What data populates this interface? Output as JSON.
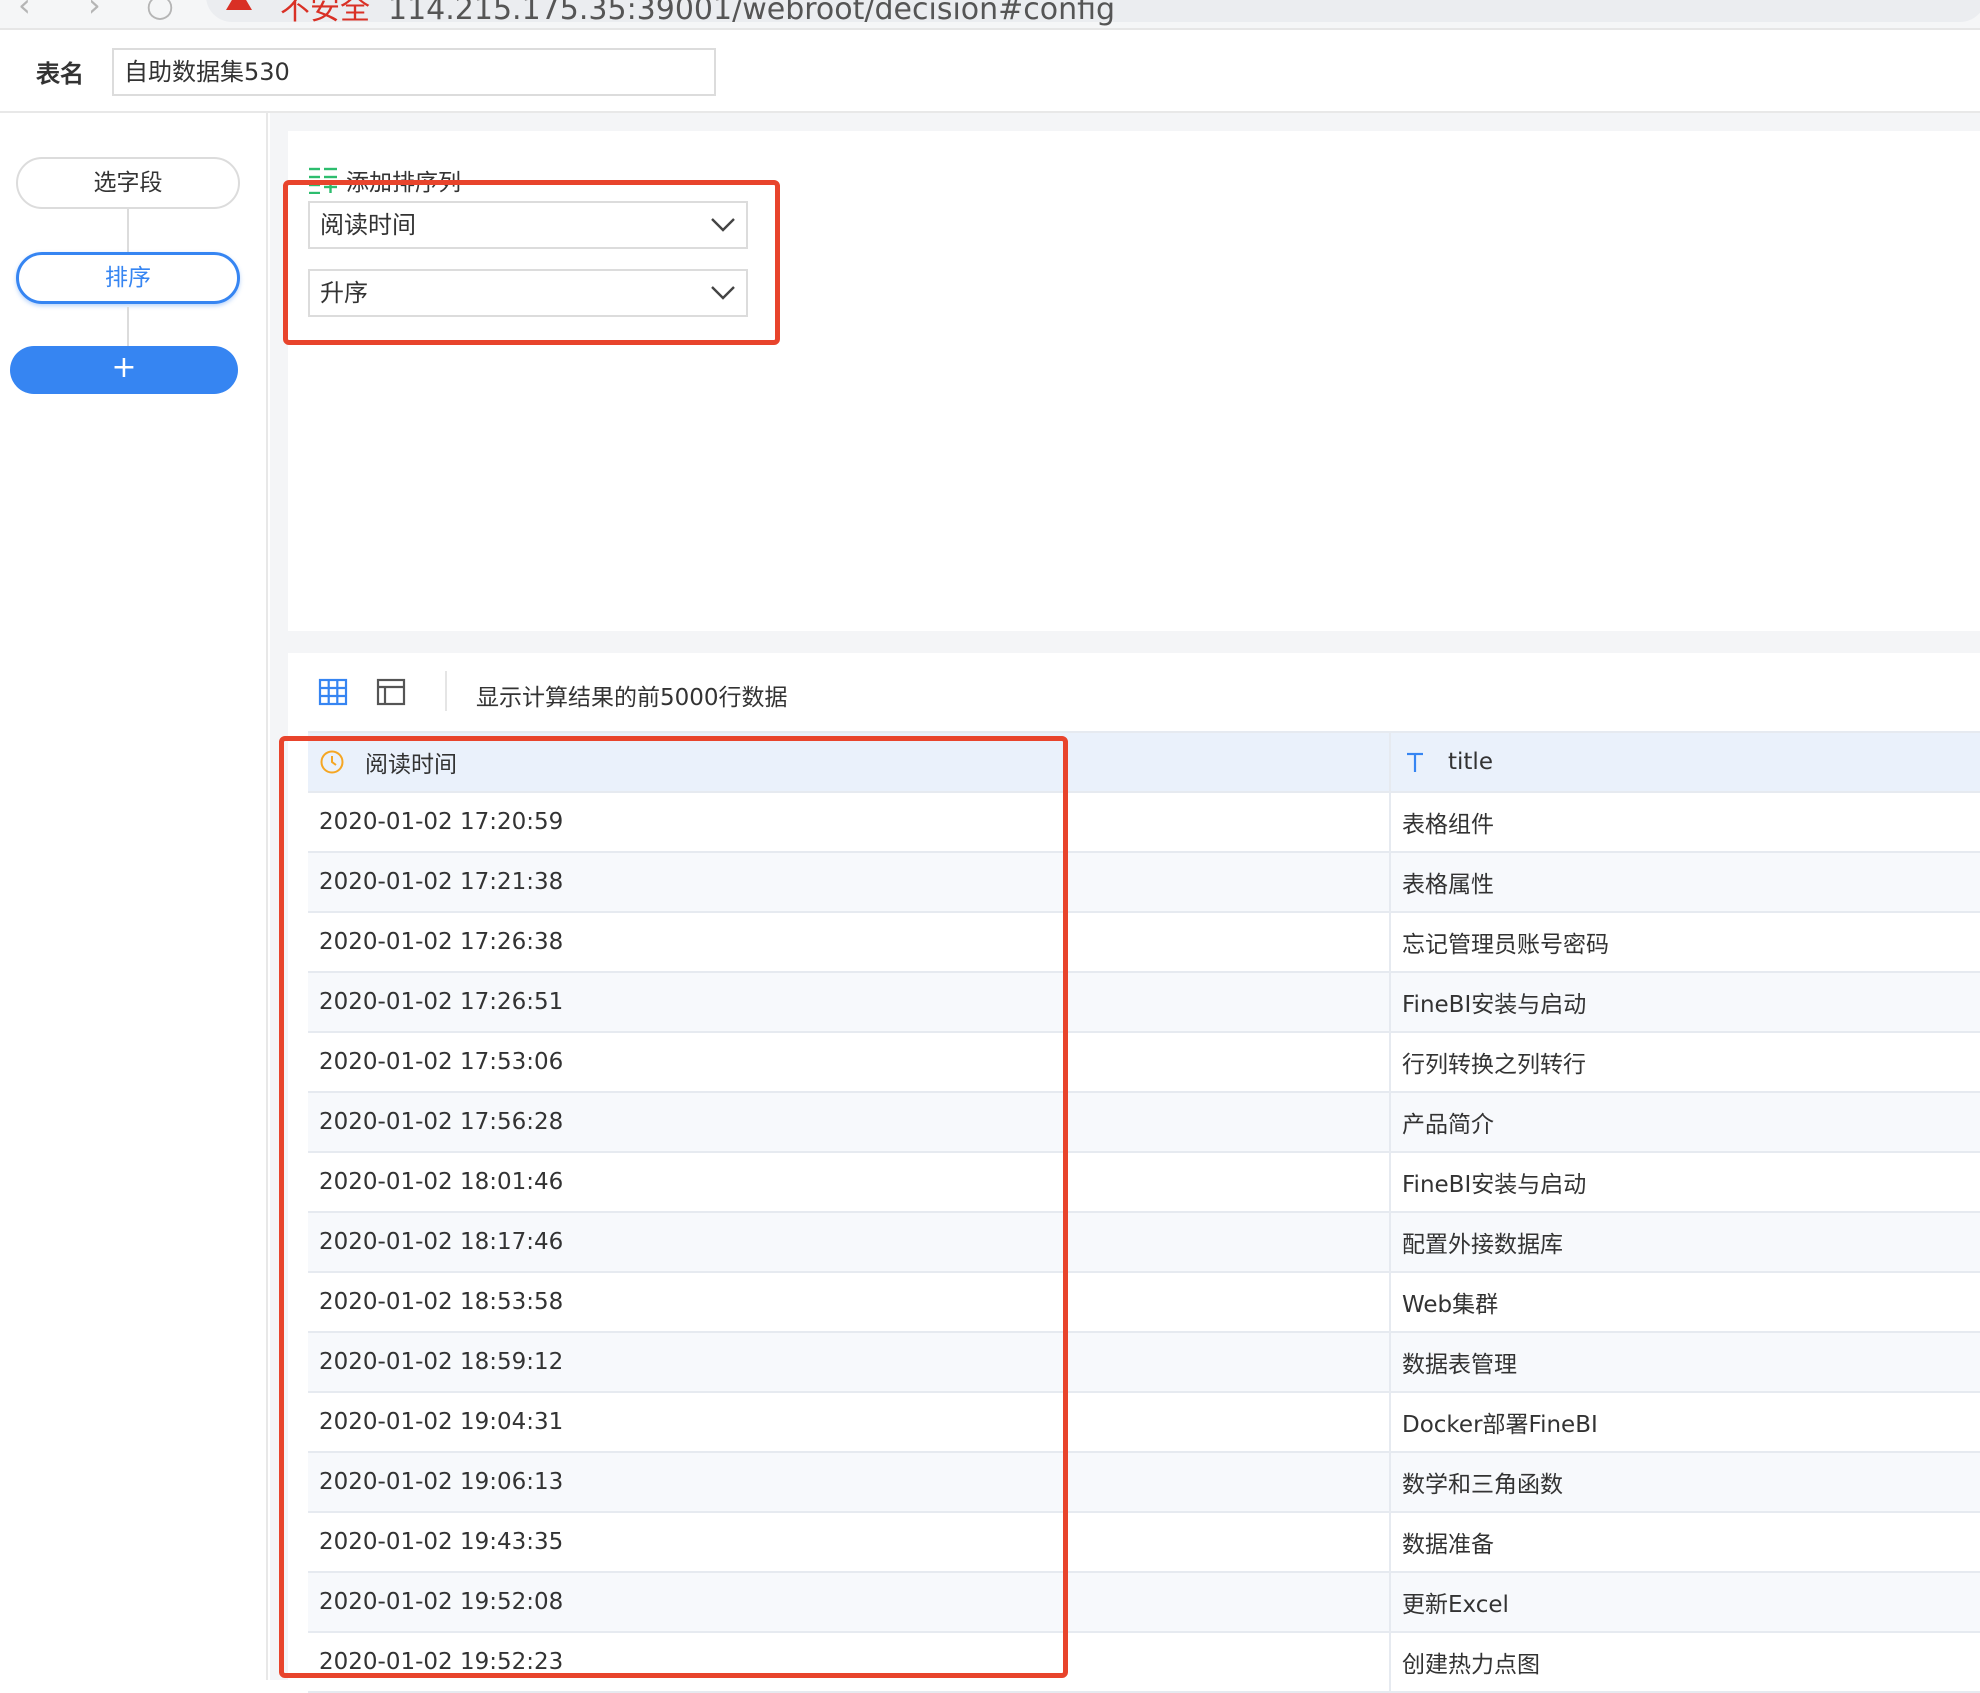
{
  "browser": {
    "security_text": "不安全",
    "url": "114.215.175.35:39001/webroot/decision#config"
  },
  "header": {
    "table_name_label": "表名",
    "table_name_value": "自助数据集530"
  },
  "steps": {
    "select_fields": "选字段",
    "sort": "排序",
    "add": "+"
  },
  "sort_config": {
    "add_sort_column": "添加排序列",
    "field": "阅读时间",
    "order": "升序"
  },
  "preview": {
    "note": "显示计算结果的前5000行数据",
    "columns": [
      {
        "name": "阅读时间",
        "type_icon": "clock-icon"
      },
      {
        "name": "title",
        "type_icon": "text-type-icon"
      }
    ],
    "rows": [
      [
        "2020-01-02 17:20:59",
        "表格组件"
      ],
      [
        "2020-01-02 17:21:38",
        "表格属性"
      ],
      [
        "2020-01-02 17:26:38",
        "忘记管理员账号密码"
      ],
      [
        "2020-01-02 17:26:51",
        "FineBI安装与启动"
      ],
      [
        "2020-01-02 17:53:06",
        "行列转换之列转行"
      ],
      [
        "2020-01-02 17:56:28",
        "产品简介"
      ],
      [
        "2020-01-02 18:01:46",
        "FineBI安装与启动"
      ],
      [
        "2020-01-02 18:17:46",
        "配置外接数据库"
      ],
      [
        "2020-01-02 18:53:58",
        "Web集群"
      ],
      [
        "2020-01-02 18:59:12",
        "数据表管理"
      ],
      [
        "2020-01-02 19:04:31",
        "Docker部署FineBI"
      ],
      [
        "2020-01-02 19:06:13",
        "数学和三角函数"
      ],
      [
        "2020-01-02 19:43:35",
        "数据准备"
      ],
      [
        "2020-01-02 19:52:08",
        "更新Excel"
      ],
      [
        "2020-01-02 19:52:23",
        "创建热力点图"
      ]
    ]
  },
  "colors": {
    "accent": "#3685f2",
    "highlight": "#e8442c",
    "add_sort_icon": "#2dbd6e",
    "clock_icon": "#f5a623"
  }
}
